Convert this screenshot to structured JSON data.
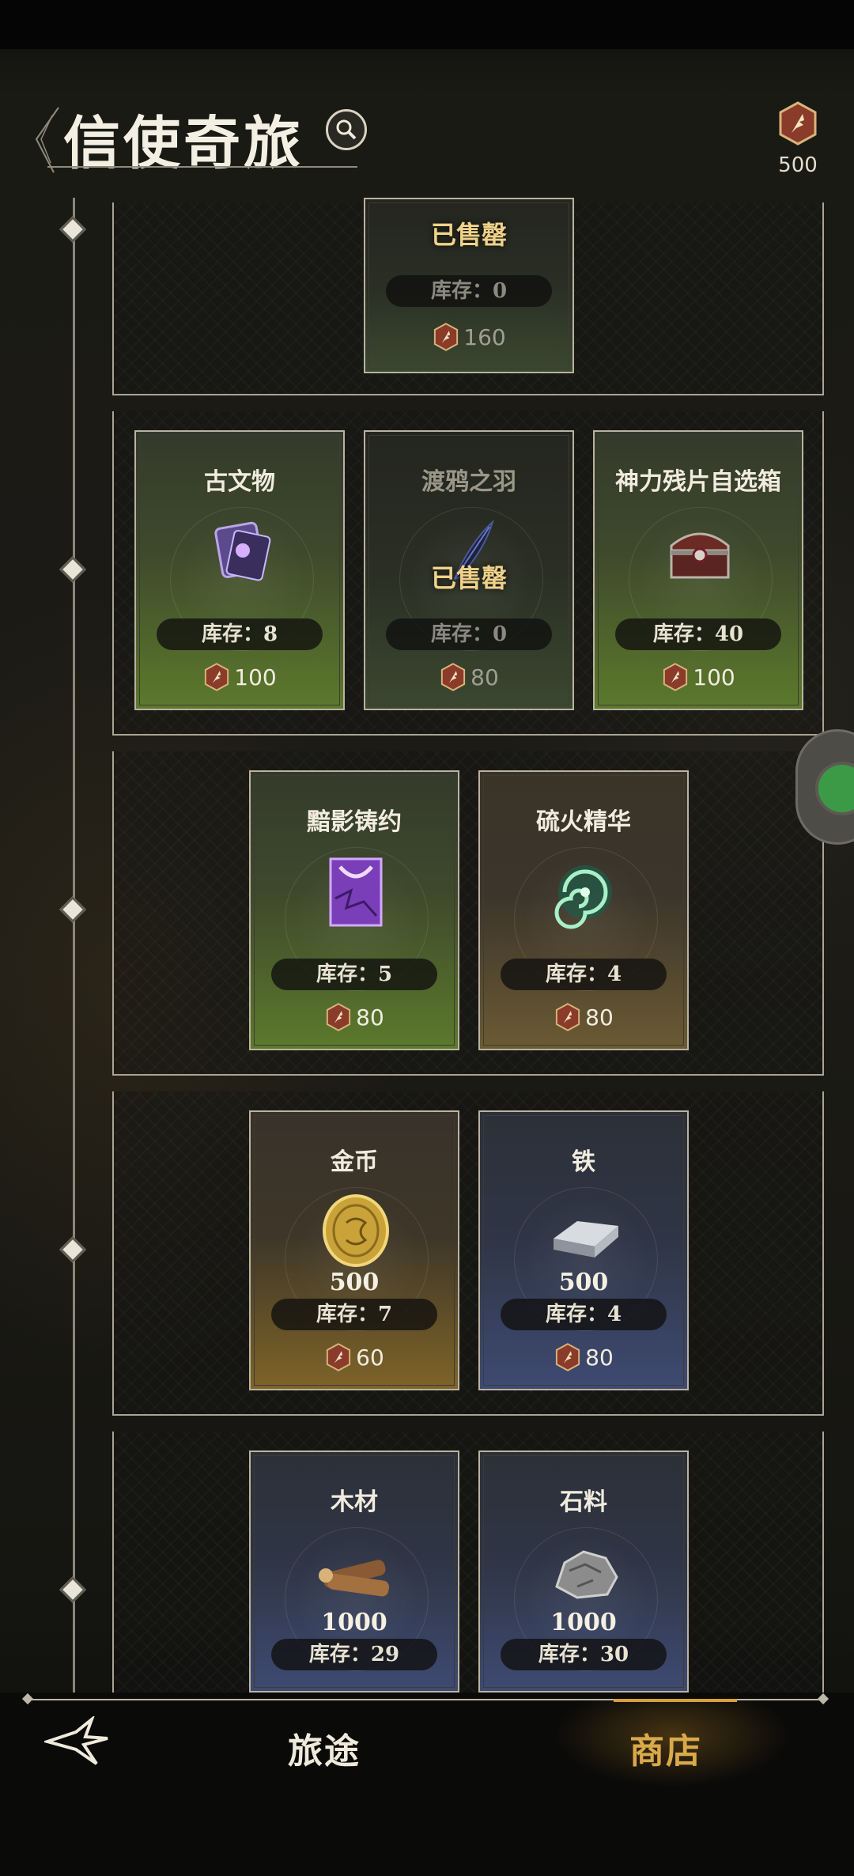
{
  "header": {
    "title": "信使奇旅",
    "currency_amount": "500"
  },
  "groups": [
    {
      "cards": [
        {
          "name": "",
          "soldout": "已售罄",
          "stock": "库存：0",
          "price": "160",
          "theme": "dim"
        }
      ]
    },
    {
      "cards": [
        {
          "name": "古文物",
          "stock": "库存：8",
          "price": "100",
          "theme": "green",
          "icon": "artifact-icon"
        },
        {
          "name": "渡鸦之羽",
          "soldout": "已售罄",
          "stock": "库存：0",
          "price": "80",
          "theme": "dim",
          "icon": "raven-feather-icon"
        },
        {
          "name": "神力残片自选箱",
          "stock": "库存：40",
          "price": "100",
          "theme": "brown",
          "icon": "chest-icon"
        }
      ]
    },
    {
      "cards": [
        {
          "name": "黯影铸约",
          "stock": "库存：5",
          "price": "80",
          "theme": "green",
          "icon": "shadow-pact-icon"
        },
        {
          "name": "硫火精华",
          "stock": "库存：4",
          "price": "80",
          "theme": "brown",
          "icon": "sulfur-essence-icon"
        }
      ]
    },
    {
      "cards": [
        {
          "name": "金币",
          "qty": "500",
          "stock": "库存：7",
          "price": "60",
          "theme": "gold",
          "icon": "gold-coin-icon"
        },
        {
          "name": "铁",
          "qty": "500",
          "stock": "库存：4",
          "price": "80",
          "theme": "blue",
          "icon": "iron-ingot-icon"
        }
      ]
    },
    {
      "cards": [
        {
          "name": "木材",
          "qty": "1000",
          "stock": "库存：29",
          "theme": "blue",
          "icon": "wood-icon"
        },
        {
          "name": "石料",
          "qty": "1000",
          "stock": "库存：30",
          "theme": "blue",
          "icon": "stone-icon"
        }
      ]
    }
  ],
  "nav": {
    "journey": "旅途",
    "shop": "商店"
  },
  "colors": {
    "accent": "#d9a94a",
    "soldout": "#efd28a"
  }
}
